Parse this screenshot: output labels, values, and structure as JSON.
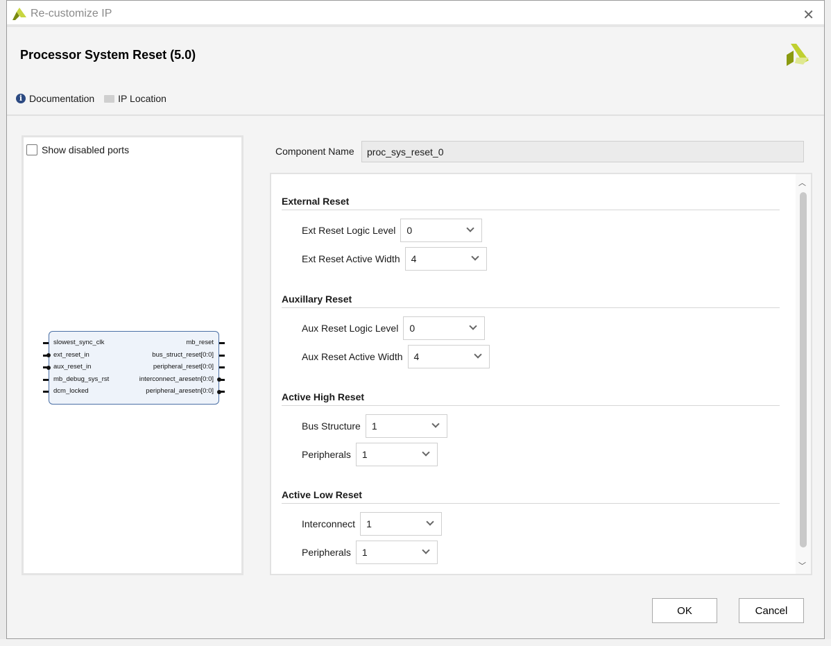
{
  "window": {
    "title": "Re-customize IP",
    "close_icon": "close-icon"
  },
  "header": {
    "ip_title": "Processor System Reset (5.0)",
    "documentation": "Documentation",
    "ip_location": "IP Location"
  },
  "left_panel": {
    "show_disabled_ports": "Show disabled ports",
    "show_disabled_checked": false,
    "block": {
      "inputs": [
        {
          "name": "slowest_sync_clk",
          "type": "line"
        },
        {
          "name": "ext_reset_in",
          "type": "bubble"
        },
        {
          "name": "aux_reset_in",
          "type": "bubble"
        },
        {
          "name": "mb_debug_sys_rst",
          "type": "line"
        },
        {
          "name": "dcm_locked",
          "type": "line"
        }
      ],
      "outputs": [
        {
          "name": "mb_reset",
          "type": "line"
        },
        {
          "name": "bus_struct_reset[0:0]",
          "type": "line"
        },
        {
          "name": "peripheral_reset[0:0]",
          "type": "line"
        },
        {
          "name": "interconnect_aresetn[0:0]",
          "type": "bubble"
        },
        {
          "name": "peripheral_aresetn[0:0]",
          "type": "bubble"
        }
      ]
    }
  },
  "component": {
    "label": "Component Name",
    "value": "proc_sys_reset_0"
  },
  "sections": [
    {
      "title": "External Reset",
      "rows": [
        {
          "label": "Ext Reset Logic Level",
          "value": "0"
        },
        {
          "label": "Ext Reset Active Width",
          "value": "4"
        }
      ]
    },
    {
      "title": "Auxillary Reset",
      "rows": [
        {
          "label": "Aux Reset Logic Level",
          "value": "0"
        },
        {
          "label": "Aux Reset Active Width",
          "value": "4"
        }
      ]
    },
    {
      "title": "Active High Reset",
      "rows": [
        {
          "label": "Bus Structure",
          "value": "1"
        },
        {
          "label": "Peripherals",
          "value": "1"
        }
      ]
    },
    {
      "title": "Active Low Reset",
      "rows": [
        {
          "label": "Interconnect",
          "value": "1"
        },
        {
          "label": "Peripherals",
          "value": "1"
        }
      ]
    }
  ],
  "buttons": {
    "ok": "OK",
    "cancel": "Cancel"
  },
  "colors": {
    "brand": "#a8b820",
    "block_border": "#4a6fa5",
    "info_icon": "#2c4a82"
  }
}
